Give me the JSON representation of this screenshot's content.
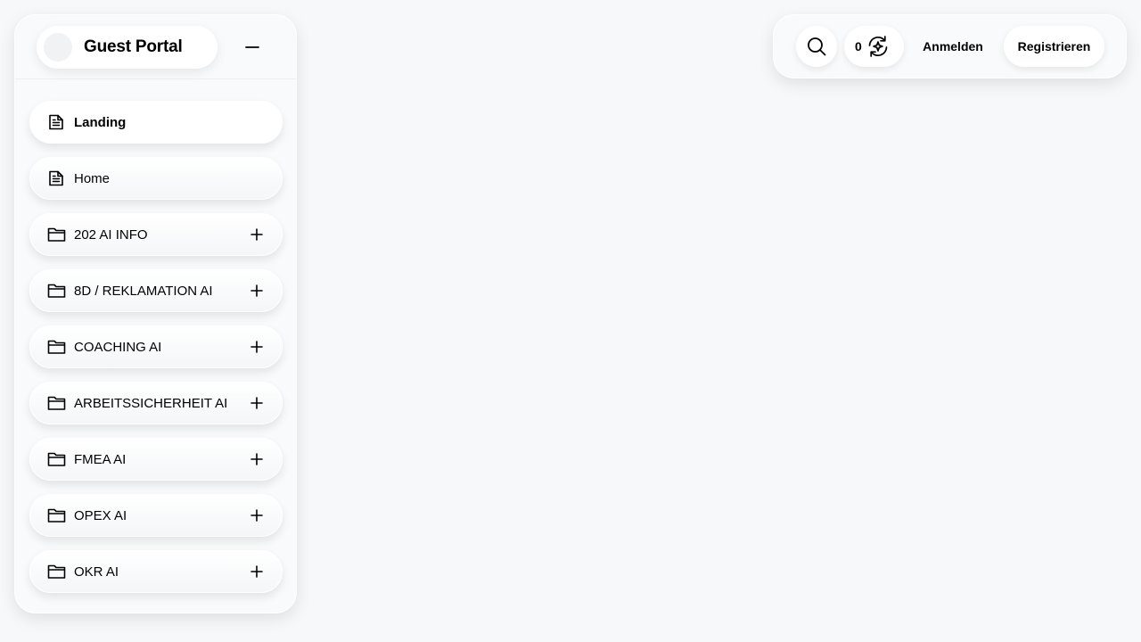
{
  "sidebar": {
    "title": "Guest Portal",
    "items": [
      {
        "label": "Landing",
        "icon": "document-icon",
        "expandable": false,
        "active": true
      },
      {
        "label": "Home",
        "icon": "document-icon",
        "expandable": false,
        "active": false
      },
      {
        "label": "202 AI INFO",
        "icon": "folder-icon",
        "expandable": true,
        "active": false
      },
      {
        "label": "8D / REKLAMATION AI",
        "icon": "folder-icon",
        "expandable": true,
        "active": false
      },
      {
        "label": "COACHING AI",
        "icon": "folder-icon",
        "expandable": true,
        "active": false
      },
      {
        "label": "ARBEITSSICHERHEIT AI",
        "icon": "folder-icon",
        "expandable": true,
        "active": false
      },
      {
        "label": "FMEA AI",
        "icon": "folder-icon",
        "expandable": true,
        "active": false
      },
      {
        "label": "OPEX AI",
        "icon": "folder-icon",
        "expandable": true,
        "active": false
      },
      {
        "label": "OKR AI",
        "icon": "folder-icon",
        "expandable": true,
        "active": false
      }
    ]
  },
  "topbar": {
    "credits_count": "0",
    "login_label": "Anmelden",
    "register_label": "Registrieren"
  },
  "colors": {
    "background": "#f6f8fa",
    "panel": "#f9fafb",
    "text": "#000000"
  }
}
